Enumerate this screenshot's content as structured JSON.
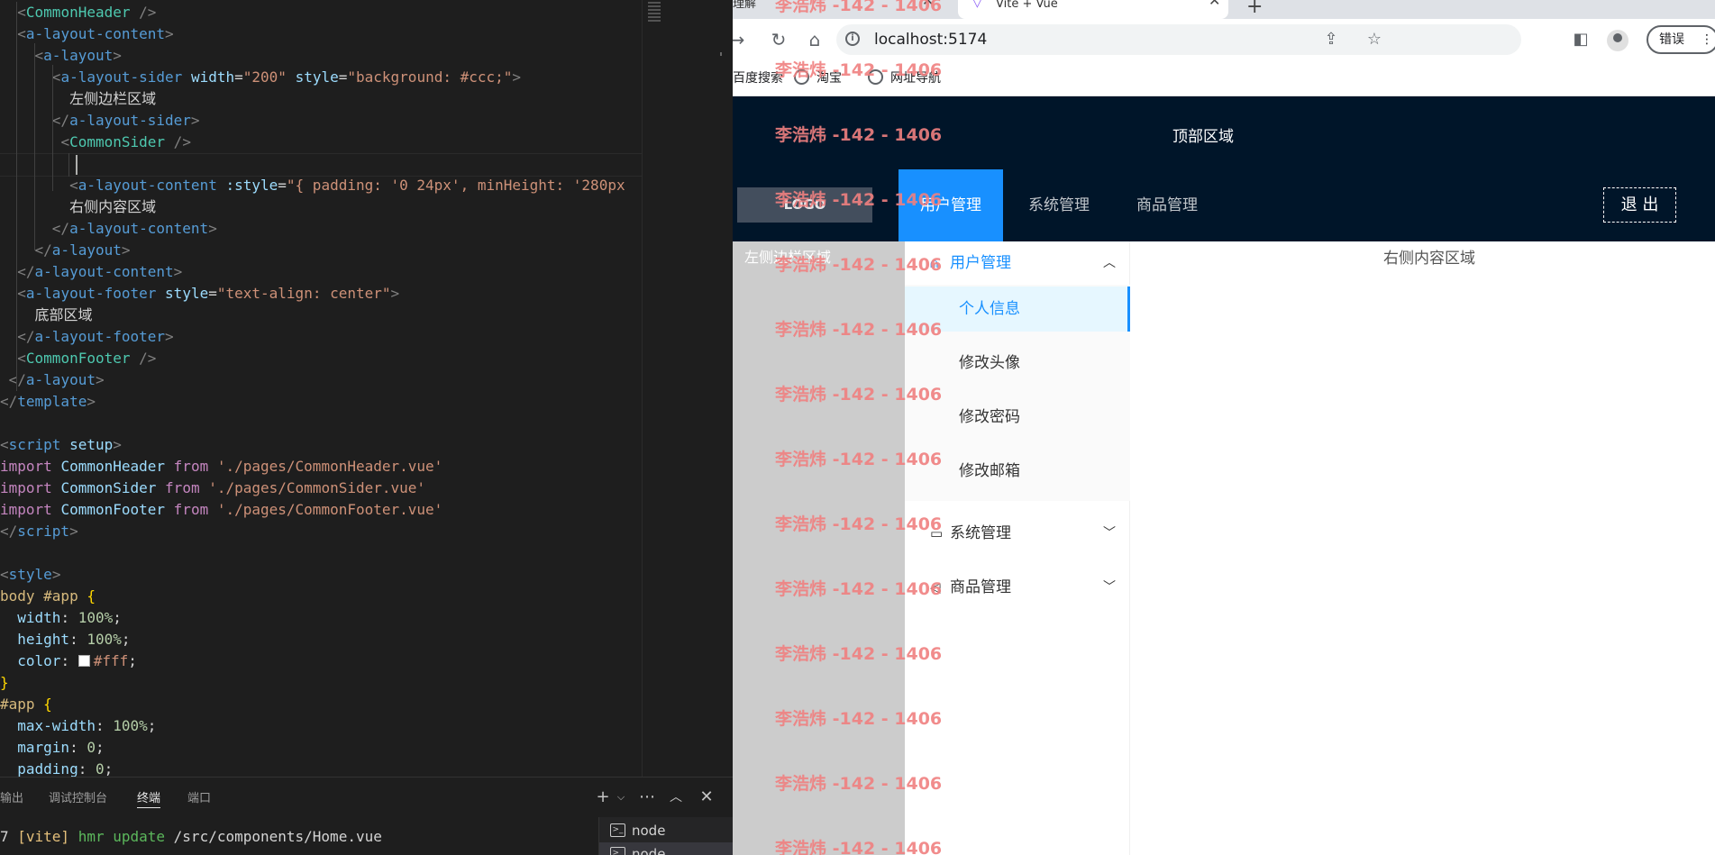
{
  "editor": {
    "code_lines": [
      {
        "indent": "  ",
        "parts": [
          [
            "punct",
            "<"
          ],
          [
            "comp",
            "CommonHeader"
          ],
          [
            "punct",
            " />"
          ]
        ]
      },
      {
        "indent": "  ",
        "parts": [
          [
            "punct",
            "<"
          ],
          [
            "tag",
            "a-layout-content"
          ],
          [
            "punct",
            ">"
          ]
        ]
      },
      {
        "indent": "    ",
        "parts": [
          [
            "punct",
            "<"
          ],
          [
            "tag",
            "a-layout"
          ],
          [
            "punct",
            ">"
          ]
        ]
      },
      {
        "indent": "      ",
        "parts": [
          [
            "punct",
            "<"
          ],
          [
            "tag",
            "a-layout-sider"
          ],
          [
            "text",
            " "
          ],
          [
            "attr",
            "width"
          ],
          [
            "text",
            "="
          ],
          [
            "str",
            "\"200\""
          ],
          [
            "text",
            " "
          ],
          [
            "attr",
            "style"
          ],
          [
            "text",
            "="
          ],
          [
            "str",
            "\"background: "
          ],
          [
            "str",
            "#ccc"
          ],
          [
            "str",
            ";\""
          ],
          [
            "punct",
            ">"
          ]
        ]
      },
      {
        "indent": "        ",
        "parts": [
          [
            "text",
            "左侧边栏区域"
          ]
        ]
      },
      {
        "indent": "      ",
        "parts": [
          [
            "punct",
            "</"
          ],
          [
            "tag",
            "a-layout-sider"
          ],
          [
            "punct",
            ">"
          ]
        ]
      },
      {
        "indent": "       ",
        "parts": [
          [
            "punct",
            "<"
          ],
          [
            "comp",
            "CommonSider"
          ],
          [
            "punct",
            " />"
          ]
        ]
      },
      {
        "indent": "",
        "parts": []
      },
      {
        "indent": "        ",
        "parts": [
          [
            "punct",
            "<"
          ],
          [
            "tag",
            "a-layout-content"
          ],
          [
            "text",
            " "
          ],
          [
            "attr",
            ":style"
          ],
          [
            "text",
            "="
          ],
          [
            "str",
            "\"{ padding: '0 24px', minHeight: '280px"
          ]
        ]
      },
      {
        "indent": "        ",
        "parts": [
          [
            "text",
            "右侧内容区域"
          ]
        ]
      },
      {
        "indent": "      ",
        "parts": [
          [
            "punct",
            "</"
          ],
          [
            "tag",
            "a-layout-content"
          ],
          [
            "punct",
            ">"
          ]
        ]
      },
      {
        "indent": "    ",
        "parts": [
          [
            "punct",
            "</"
          ],
          [
            "tag",
            "a-layout"
          ],
          [
            "punct",
            ">"
          ]
        ]
      },
      {
        "indent": "  ",
        "parts": [
          [
            "punct",
            "</"
          ],
          [
            "tag",
            "a-layout-content"
          ],
          [
            "punct",
            ">"
          ]
        ]
      },
      {
        "indent": "  ",
        "parts": [
          [
            "punct",
            "<"
          ],
          [
            "tag",
            "a-layout-footer"
          ],
          [
            "text",
            " "
          ],
          [
            "attr",
            "style"
          ],
          [
            "text",
            "="
          ],
          [
            "str",
            "\"text-align: center\""
          ],
          [
            "punct",
            ">"
          ]
        ]
      },
      {
        "indent": "    ",
        "parts": [
          [
            "text",
            "底部区域"
          ]
        ]
      },
      {
        "indent": "  ",
        "parts": [
          [
            "punct",
            "</"
          ],
          [
            "tag",
            "a-layout-footer"
          ],
          [
            "punct",
            ">"
          ]
        ]
      },
      {
        "indent": "  ",
        "parts": [
          [
            "punct",
            "<"
          ],
          [
            "comp",
            "CommonFooter"
          ],
          [
            "punct",
            " />"
          ]
        ]
      },
      {
        "indent": " ",
        "parts": [
          [
            "punct",
            "</"
          ],
          [
            "tag",
            "a-layout"
          ],
          [
            "punct",
            ">"
          ]
        ]
      },
      {
        "indent": "",
        "parts": [
          [
            "punct",
            "</"
          ],
          [
            "tag",
            "template"
          ],
          [
            "punct",
            ">"
          ]
        ]
      },
      {
        "indent": "",
        "parts": []
      },
      {
        "indent": "",
        "parts": [
          [
            "punct",
            "<"
          ],
          [
            "tag",
            "script"
          ],
          [
            "text",
            " "
          ],
          [
            "attr",
            "setup"
          ],
          [
            "punct",
            ">"
          ]
        ]
      },
      {
        "indent": "",
        "parts": [
          [
            "kw",
            "import"
          ],
          [
            "text",
            " "
          ],
          [
            "var",
            "CommonHeader"
          ],
          [
            "text",
            " "
          ],
          [
            "kw",
            "from"
          ],
          [
            "text",
            " "
          ],
          [
            "str",
            "'./pages/CommonHeader.vue'"
          ]
        ]
      },
      {
        "indent": "",
        "parts": [
          [
            "kw",
            "import"
          ],
          [
            "text",
            " "
          ],
          [
            "var",
            "CommonSider"
          ],
          [
            "text",
            " "
          ],
          [
            "kw",
            "from"
          ],
          [
            "text",
            " "
          ],
          [
            "str",
            "'./pages/CommonSider.vue'"
          ]
        ]
      },
      {
        "indent": "",
        "parts": [
          [
            "kw",
            "import"
          ],
          [
            "text",
            " "
          ],
          [
            "var",
            "CommonFooter"
          ],
          [
            "text",
            " "
          ],
          [
            "kw",
            "from"
          ],
          [
            "text",
            " "
          ],
          [
            "str",
            "'./pages/CommonFooter.vue'"
          ]
        ]
      },
      {
        "indent": "",
        "parts": [
          [
            "punct",
            "</"
          ],
          [
            "tag",
            "script"
          ],
          [
            "punct",
            ">"
          ]
        ]
      },
      {
        "indent": "",
        "parts": []
      },
      {
        "indent": "",
        "parts": [
          [
            "punct",
            "<"
          ],
          [
            "tag",
            "style"
          ],
          [
            "punct",
            ">"
          ]
        ]
      },
      {
        "indent": "",
        "parts": [
          [
            "sel",
            "body #app"
          ],
          [
            "text",
            " "
          ],
          [
            "brace",
            "{"
          ]
        ]
      },
      {
        "indent": "  ",
        "parts": [
          [
            "prop",
            "width"
          ],
          [
            "text",
            ": "
          ],
          [
            "num",
            "100%"
          ],
          [
            "text",
            ";"
          ]
        ]
      },
      {
        "indent": "  ",
        "parts": [
          [
            "prop",
            "height"
          ],
          [
            "text",
            ": "
          ],
          [
            "num",
            "100%"
          ],
          [
            "text",
            ";"
          ]
        ]
      },
      {
        "indent": "  ",
        "parts": [
          [
            "prop",
            "color"
          ],
          [
            "text",
            ": "
          ],
          [
            "swatch",
            ""
          ],
          [
            "str",
            "#fff"
          ],
          [
            "text",
            ";"
          ]
        ]
      },
      {
        "indent": "",
        "parts": [
          [
            "brace",
            "}"
          ]
        ]
      },
      {
        "indent": "",
        "parts": [
          [
            "sel",
            "#app"
          ],
          [
            "text",
            " "
          ],
          [
            "brace",
            "{"
          ]
        ]
      },
      {
        "indent": "  ",
        "parts": [
          [
            "prop",
            "max-width"
          ],
          [
            "text",
            ": "
          ],
          [
            "num",
            "100%"
          ],
          [
            "text",
            ";"
          ]
        ]
      },
      {
        "indent": "  ",
        "parts": [
          [
            "prop",
            "margin"
          ],
          [
            "text",
            ": "
          ],
          [
            "num",
            "0"
          ],
          [
            "text",
            ";"
          ]
        ]
      },
      {
        "indent": "  ",
        "parts": [
          [
            "prop",
            "padding"
          ],
          [
            "text",
            ": "
          ],
          [
            "num",
            "0"
          ],
          [
            "text",
            ";"
          ]
        ]
      }
    ]
  },
  "panel": {
    "tabs": [
      "输出",
      "调试控制台",
      "终端",
      "端口"
    ],
    "active_tab": "终端",
    "terminal_line": {
      "prefix": "7 ",
      "vite": "[vite]",
      "hmr": " hmr update",
      "path": " /src/components/Home.vue"
    },
    "terminals": [
      "node",
      "node"
    ]
  },
  "browser": {
    "tabs": [
      {
        "title": "理解"
      },
      {
        "title": "Vite + Vue"
      }
    ],
    "url": "localhost:5174",
    "error_button": "错误",
    "bookmarks": [
      "百度搜索",
      "淘宝",
      "网址导航"
    ]
  },
  "app": {
    "top_area_label": "顶部区域",
    "logo": "LOGO",
    "header_menu": [
      "用户管理",
      "系统管理",
      "商品管理"
    ],
    "header_active": "用户管理",
    "logout": "退 出",
    "sider_label": "左侧边栏区域",
    "content_label": "右侧内容区域",
    "side_menu": [
      {
        "label": "用户管理",
        "icon": "user-icon",
        "open": true,
        "children": [
          "个人信息",
          "修改头像",
          "修改密码",
          "修改邮箱"
        ],
        "selected": "个人信息"
      },
      {
        "label": "系统管理",
        "icon": "laptop-icon",
        "open": false
      },
      {
        "label": "商品管理",
        "icon": "notification-icon",
        "open": false
      }
    ]
  },
  "watermark": "李浩炜 -142 - 1406"
}
